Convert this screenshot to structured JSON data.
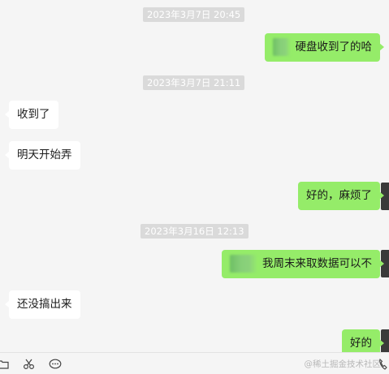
{
  "timestamps": [
    "2023年3月7日 20:45",
    "2023年3月7日 21:11",
    "2023年3月16日 12:13"
  ],
  "messages": [
    {
      "dir": "out",
      "text": "硬盘收到了的哈",
      "redacted_prefix": true
    },
    {
      "dir": "in",
      "text": "收到了"
    },
    {
      "dir": "in",
      "text": "明天开始弄"
    },
    {
      "dir": "out",
      "text": "好的，麻烦了"
    },
    {
      "dir": "out",
      "text": "我周末来取数据可以不",
      "redacted_prefix": true
    },
    {
      "dir": "in",
      "text": "还没搞出来"
    },
    {
      "dir": "out",
      "text": "好的"
    }
  ],
  "toolbar": {
    "icons": [
      "folder-icon",
      "scissors-icon",
      "chat-bubble-icon",
      "phone-icon"
    ],
    "watermark": "@稀土掘金技术社区"
  },
  "colors": {
    "background": "#f5f5f5",
    "outgoing_bubble": "#95ec69",
    "incoming_bubble": "#ffffff",
    "timestamp_bg": "#dadada"
  }
}
